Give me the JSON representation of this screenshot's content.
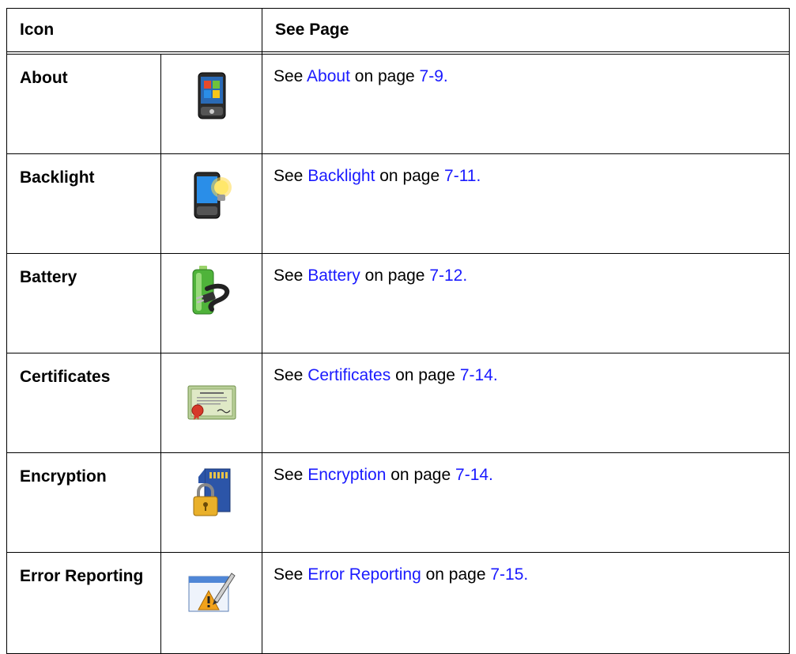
{
  "header": {
    "icon": "Icon",
    "see_page": "See Page"
  },
  "rows": [
    {
      "name": "About",
      "icon": "pocket-pc-phone-icon",
      "prefix": "See ",
      "link": "About",
      "mid": " on page ",
      "page": "7-9",
      "suffix": "."
    },
    {
      "name": "Backlight",
      "icon": "phone-lightbulb-icon",
      "prefix": "See ",
      "link": "Backlight",
      "mid": " on page ",
      "page": "7-11",
      "suffix": "."
    },
    {
      "name": "Battery",
      "icon": "battery-plug-icon",
      "prefix": "See ",
      "link": "Battery",
      "mid": " on page ",
      "page": "7-12",
      "suffix": "."
    },
    {
      "name": "Certificates",
      "icon": "certificate-icon",
      "prefix": "See ",
      "link": "Certificates",
      "mid": " on page ",
      "page": "7-14",
      "suffix": "."
    },
    {
      "name": "Encryption",
      "icon": "sd-card-lock-icon",
      "prefix": "See ",
      "link": "Encryption",
      "mid": " on page ",
      "page": "7-14",
      "suffix": "."
    },
    {
      "name": "Error Reporting",
      "icon": "error-reporting-icon",
      "prefix": "See ",
      "link": "Error Reporting",
      "mid": " on page ",
      "page": "7-15",
      "suffix": "."
    }
  ],
  "colors": {
    "link": "#1a1aff",
    "border": "#000000"
  }
}
